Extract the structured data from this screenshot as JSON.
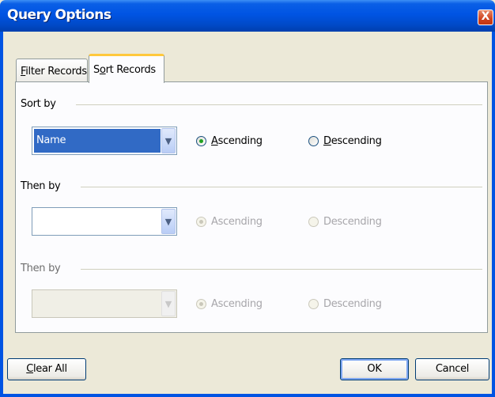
{
  "window": {
    "title": "Query Options",
    "close_glyph": "X"
  },
  "tabs": [
    {
      "label_prefix": "",
      "label_u": "F",
      "label_rest": "ilter Records",
      "active": false
    },
    {
      "label_prefix": "S",
      "label_u": "o",
      "label_rest": "rt Records",
      "active": true
    }
  ],
  "groups": [
    {
      "label_u": "S",
      "label_rest": "ort by",
      "value": "Name",
      "enabled": true,
      "ascending": {
        "u": "A",
        "rest": "scending",
        "checked": true
      },
      "descending": {
        "u": "D",
        "rest": "escending",
        "checked": false
      }
    },
    {
      "label_u": "T",
      "label_rest": "hen by",
      "value": "",
      "enabled": false,
      "ascending": {
        "u": "",
        "rest": "Ascending",
        "checked": true
      },
      "descending": {
        "u": "",
        "rest": "Descending",
        "checked": false
      }
    },
    {
      "label_pre": "Then ",
      "label_u": "b",
      "label_rest": "y",
      "value": "",
      "enabled": false,
      "ascending": {
        "u": "",
        "rest": "Ascending",
        "checked": true
      },
      "descending": {
        "u": "",
        "rest": "Descending",
        "checked": false
      }
    }
  ],
  "buttons": {
    "clear_all_u": "C",
    "clear_all_rest": "lear All",
    "ok": "OK",
    "cancel": "Cancel"
  },
  "icons": {
    "dropdown": "chevron-down-icon",
    "close": "close-icon"
  },
  "colors": {
    "titlebar": "#0054e3",
    "selection": "#316ac5",
    "dialog_bg": "#ece9d8",
    "tab_highlight": "#ffc83c"
  }
}
